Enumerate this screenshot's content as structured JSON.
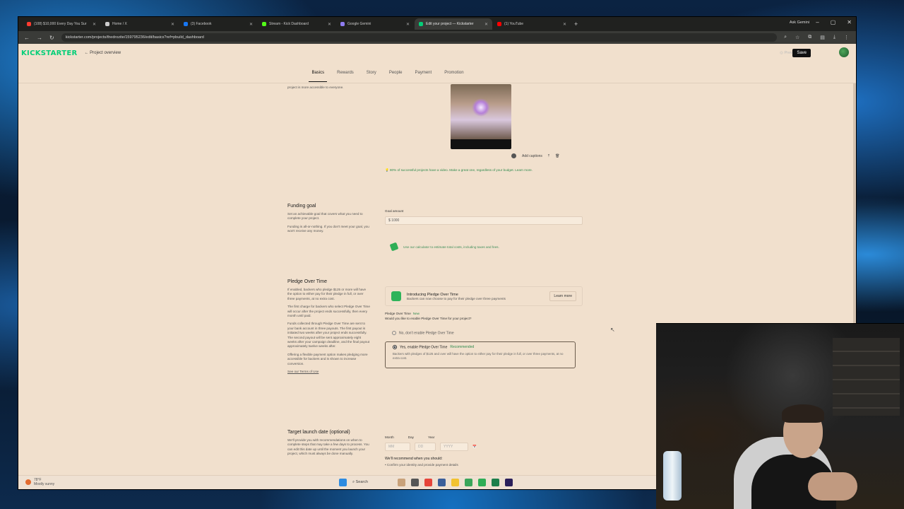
{
  "browser": {
    "tabs": [
      {
        "label": "(108) $10,000 Every Day You Sur",
        "color": "#ff3b30"
      },
      {
        "label": "Home / X",
        "color": "#cccccc"
      },
      {
        "label": "(3) Facebook",
        "color": "#1877f2"
      },
      {
        "label": "Stream - Kick Dashboard",
        "color": "#53fc18"
      },
      {
        "label": "Google Gemini",
        "color": "#8e7cf0"
      },
      {
        "label": "Edit your project — Kickstarter",
        "color": "#05ce78"
      },
      {
        "label": "(1) YouTube",
        "color": "#ff0000"
      }
    ],
    "url": "kickstarter.com/projects/thedrozite/159795236/edit/basics?ref=pbuild_dashboard",
    "gemini_label": "Ask Gemini"
  },
  "header": {
    "logo": "KICKSTARTER",
    "back_link": "Project overview",
    "preview_label": "Preview",
    "save_label": "Save"
  },
  "nav_tabs": [
    "Basics",
    "Rewards",
    "Story",
    "People",
    "Payment",
    "Promotion"
  ],
  "video": {
    "top_note": "project is more accessible to everyone.",
    "captions_label": "Add captions",
    "hint": "80% of successful projects have a video. Make a great one, regardless of your budget. Learn more."
  },
  "funding": {
    "title": "Funding goal",
    "desc1": "Set an achievable goal that covers what you need to complete your project.",
    "desc2": "Funding is all-or-nothing. If you don't meet your goal, you won't receive any money.",
    "field_label": "Goal amount",
    "value": "$  1000",
    "calc_text": "Use our calculator to estimate total costs, including taxes and fees."
  },
  "pledge": {
    "title": "Pledge Over Time",
    "desc1": "If enabled, backers who pledge $125 or more will have the option to either pay for their pledge in full, or over three payments, at no extra cost.",
    "desc2": "The first charge for backers who select Pledge Over Time will occur after the project ends successfully, then every month until paid.",
    "desc3": "Funds collected through Pledge Over Time are sent to your bank account in three payouts. The first payout is initiated two weeks after your project ends successfully. The second payout will be sent approximately eight weeks after your campaign deadline, and the final payout approximately twelve weeks after.",
    "desc4": "Offering a flexible payment option makes pledging more accessible for backers and is shown to increase conversion.",
    "terms": "See our Terms of Use",
    "promo_title": "Introducing Pledge Over Time",
    "promo_sub": "Backers can now choose to pay for their pledge over three payments",
    "learn_more": "Learn more",
    "question_title": "Pledge Over Time",
    "new_badge": "New",
    "question": "Would you like to enable Pledge Over Time for your project?",
    "opt_no": "No, don't enable Pledge Over Time",
    "opt_yes": "Yes, enable Pledge Over Time",
    "recommended": "Recommended",
    "opt_yes_desc": "Backers with pledges of $125 and over will have the option to either pay for their pledge in full, or over three payments, at no extra cost."
  },
  "launch": {
    "title": "Target launch date (optional)",
    "desc": "We'll provide you with recommendations on when to complete steps that may take a few days to process. You can edit this date up until the moment you launch your project, which must always be done manually.",
    "month_label": "Month",
    "day_label": "Day",
    "year_label": "Year",
    "month_ph": "MM",
    "day_ph": "DD",
    "year_ph": "YYYY",
    "rec_title": "We'll recommend when you should:",
    "rec_item": "Confirm your identity and provide payment details"
  },
  "taskbar": {
    "weather_temp": "78°F",
    "weather_desc": "Mostly sunny",
    "search": "Search"
  }
}
